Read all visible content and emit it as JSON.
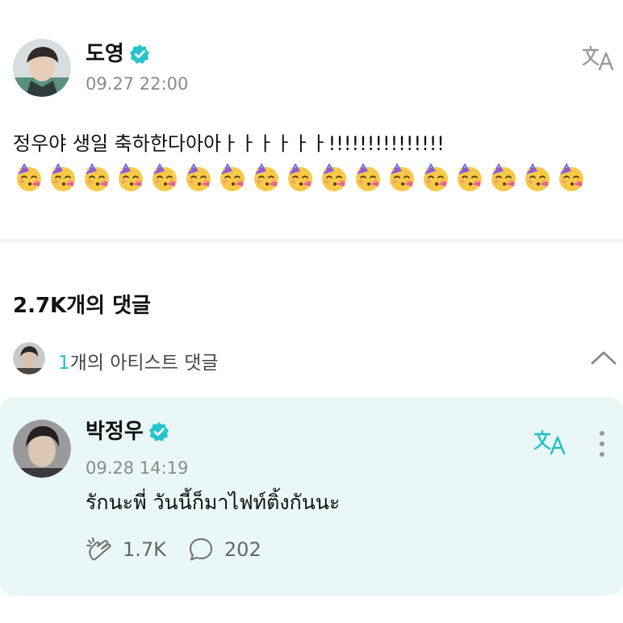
{
  "post": {
    "author": "도영",
    "time": "09.27 22:00",
    "text": "정우야 생일 축하한다아아ㅏㅏㅏㅏㅏㅏ!!!!!!!!!!!!!!!",
    "emoji_name": "partying-face-emoji",
    "emoji_count": 17
  },
  "comments": {
    "count_label": "2.7K개의 댓글"
  },
  "artist_comments": {
    "count": "1",
    "label": "개의 아티스트 댓글"
  },
  "comment": {
    "author": "박정우",
    "time": "09.28 14:19",
    "text": "รักนะพี่ วันนี้ก็มาไฟท์ติ้งกันนะ",
    "likes": "1.7K",
    "replies": "202"
  },
  "icons": {
    "verified": "verified-badge-icon",
    "translate": "translate-icon",
    "chevron": "chevron-up-icon",
    "more": "more-vertical-icon",
    "like": "like-icon",
    "reply": "reply-icon"
  },
  "colors": {
    "accent": "#1ec0c6",
    "card_background": "#e9f8f6",
    "time_text": "#8a8a8a"
  }
}
